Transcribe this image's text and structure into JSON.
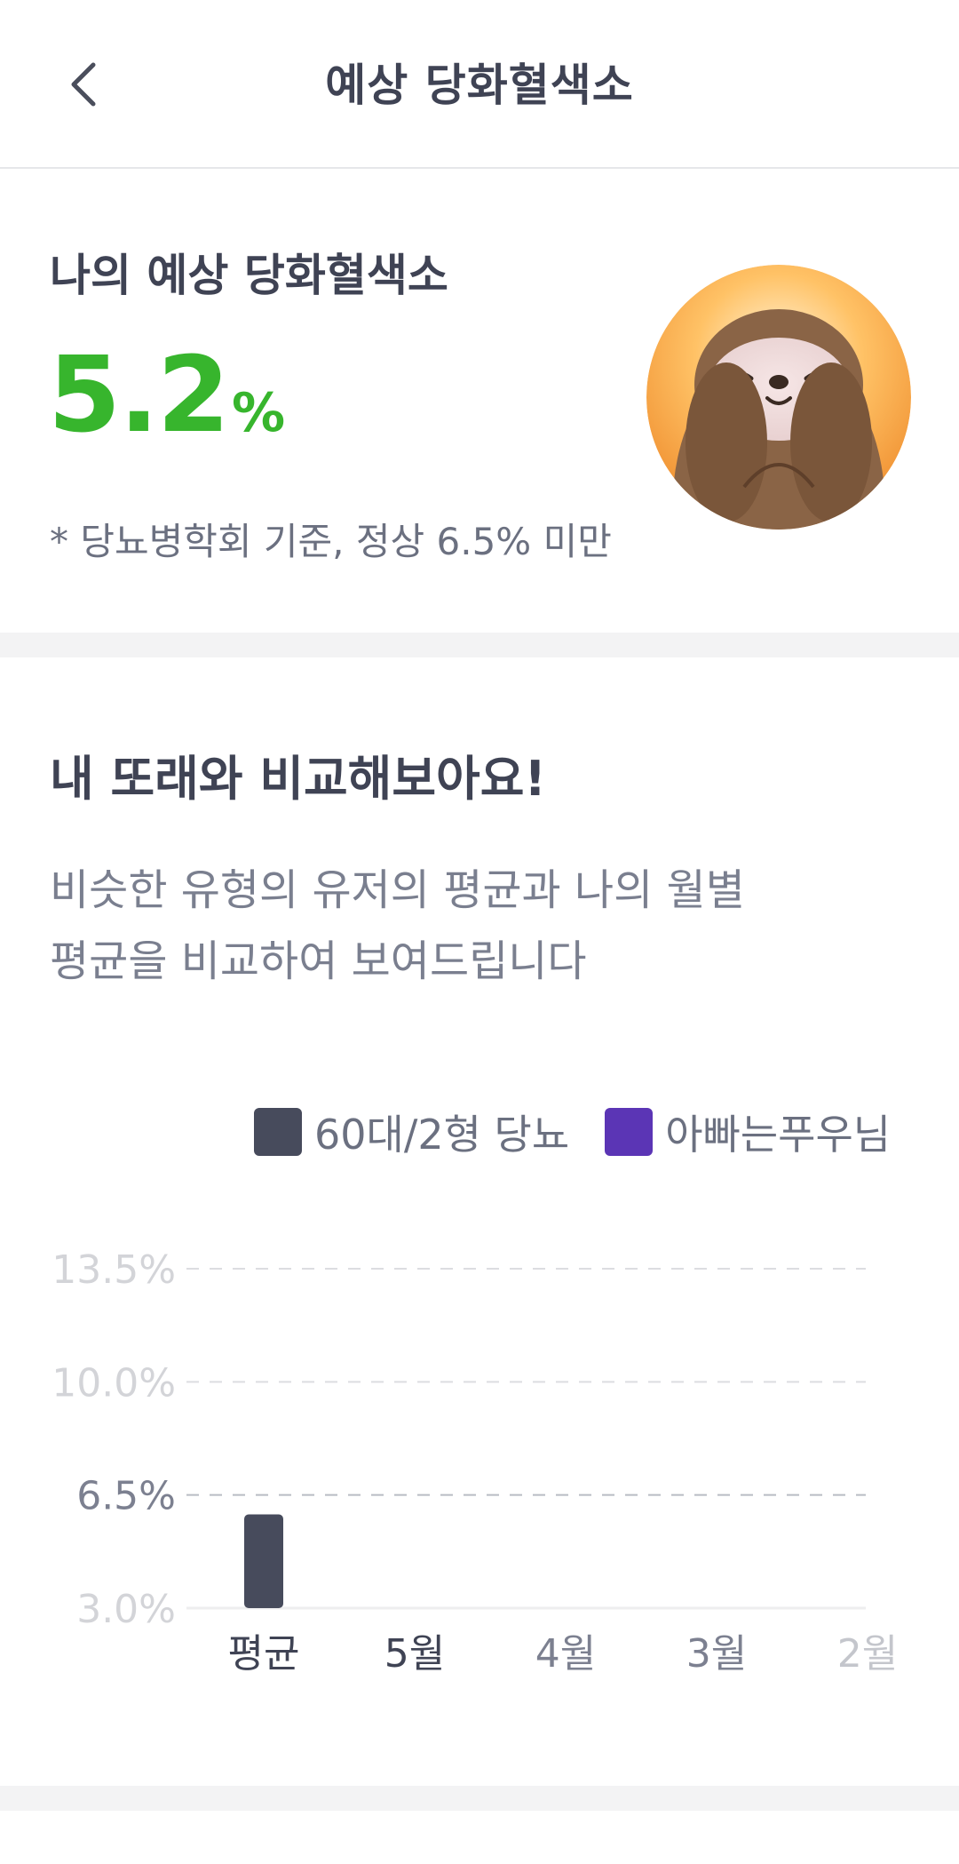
{
  "header": {
    "back_icon": "chevron-left-icon",
    "title": "예상 당화혈색소"
  },
  "summary": {
    "label": "나의 예상 당화혈색소",
    "value": "5.2",
    "unit": "%",
    "criteria": "* 당뇨병학회 기준, 정상 6.5% 미만",
    "accent_color": "#37b52d"
  },
  "compare": {
    "title": "내 또래와 비교해보아요!",
    "description_line1": "비슷한 유형의 유저의 평균과 나의 월별",
    "description_line2": "평균을 비교하여 보여드립니다"
  },
  "legend": [
    {
      "label": "60대/2형 당뇨",
      "color": "#474b5c"
    },
    {
      "label": "아빠는푸우님",
      "color": "#5b35b5"
    }
  ],
  "chart_data": {
    "type": "bar",
    "categories": [
      "평균",
      "5월",
      "4월",
      "3월",
      "2월"
    ],
    "series": [
      {
        "name": "60대/2형 당뇨",
        "values": [
          5.9,
          null,
          null,
          null,
          null
        ]
      },
      {
        "name": "아빠는푸우님",
        "values": [
          null,
          null,
          null,
          null,
          null
        ]
      }
    ],
    "yticks": [
      "3.0%",
      "6.5%",
      "10.0%",
      "13.5%"
    ],
    "ytick_values": [
      3.0,
      6.5,
      10.0,
      13.5
    ],
    "ylim": [
      3.0,
      13.5
    ],
    "grid": true,
    "colors": [
      "#474b5c",
      "#5b35b5"
    ],
    "title": "",
    "xlabel": "",
    "ylabel": ""
  }
}
